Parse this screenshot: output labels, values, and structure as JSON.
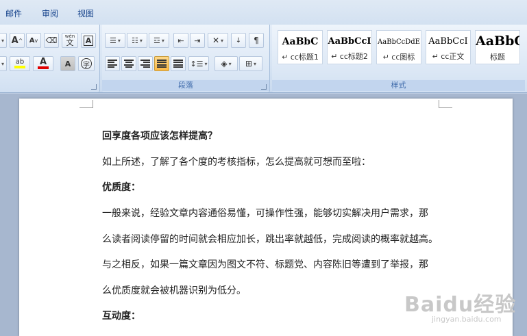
{
  "tabs": [
    "邮件",
    "审阅",
    "视图"
  ],
  "font_group": {
    "grow_font": "A",
    "shrink_font": "A",
    "phonetic_label": "wén",
    "phonetic_char": "文",
    "boxed_a": "A",
    "highlight_label": "ab",
    "font_color_a": "A",
    "char_shading_a": "A",
    "enclose_char": "字",
    "highlight_color": "#ffff00",
    "font_color": "#e00000"
  },
  "paragraph_group": {
    "label": "段落"
  },
  "styles_group": {
    "label": "样式",
    "items": [
      {
        "sample": "AaBbC",
        "name": "cc标题1"
      },
      {
        "sample": "AaBbCcI",
        "name": "cc标题2"
      },
      {
        "sample": "AaBbCcDdE",
        "name": "cc图标"
      },
      {
        "sample": "AaBbCcI",
        "name": "cc正文"
      },
      {
        "sample": "AaBbC",
        "name": "标题"
      }
    ]
  },
  "document": {
    "lines": [
      {
        "text": "回享度各项应该怎样提高？",
        "bold": true
      },
      {
        "text": "如上所述，了解了各个度的考核指标，怎么提高就可想而至啦：",
        "bold": false
      },
      {
        "text": "优质度：",
        "bold": true
      },
      {
        "text": "一般来说，经验文章内容通俗易懂，可操作性强，能够切实解决用户需求，那",
        "bold": false
      },
      {
        "text": "么读者阅读停留的时间就会相应加长，跳出率就越低，完成阅读的概率就越高。",
        "bold": false
      },
      {
        "text": "与之相反，如果一篇文章因为图文不符、标题党、内容陈旧等遭到了举报，那",
        "bold": false
      },
      {
        "text": "么优质度就会被机器识别为低分。",
        "bold": false
      },
      {
        "text": "互动度：",
        "bold": true
      }
    ]
  },
  "watermark": {
    "logo": "Baidu经验",
    "url": "jingyan.baidu.com"
  }
}
